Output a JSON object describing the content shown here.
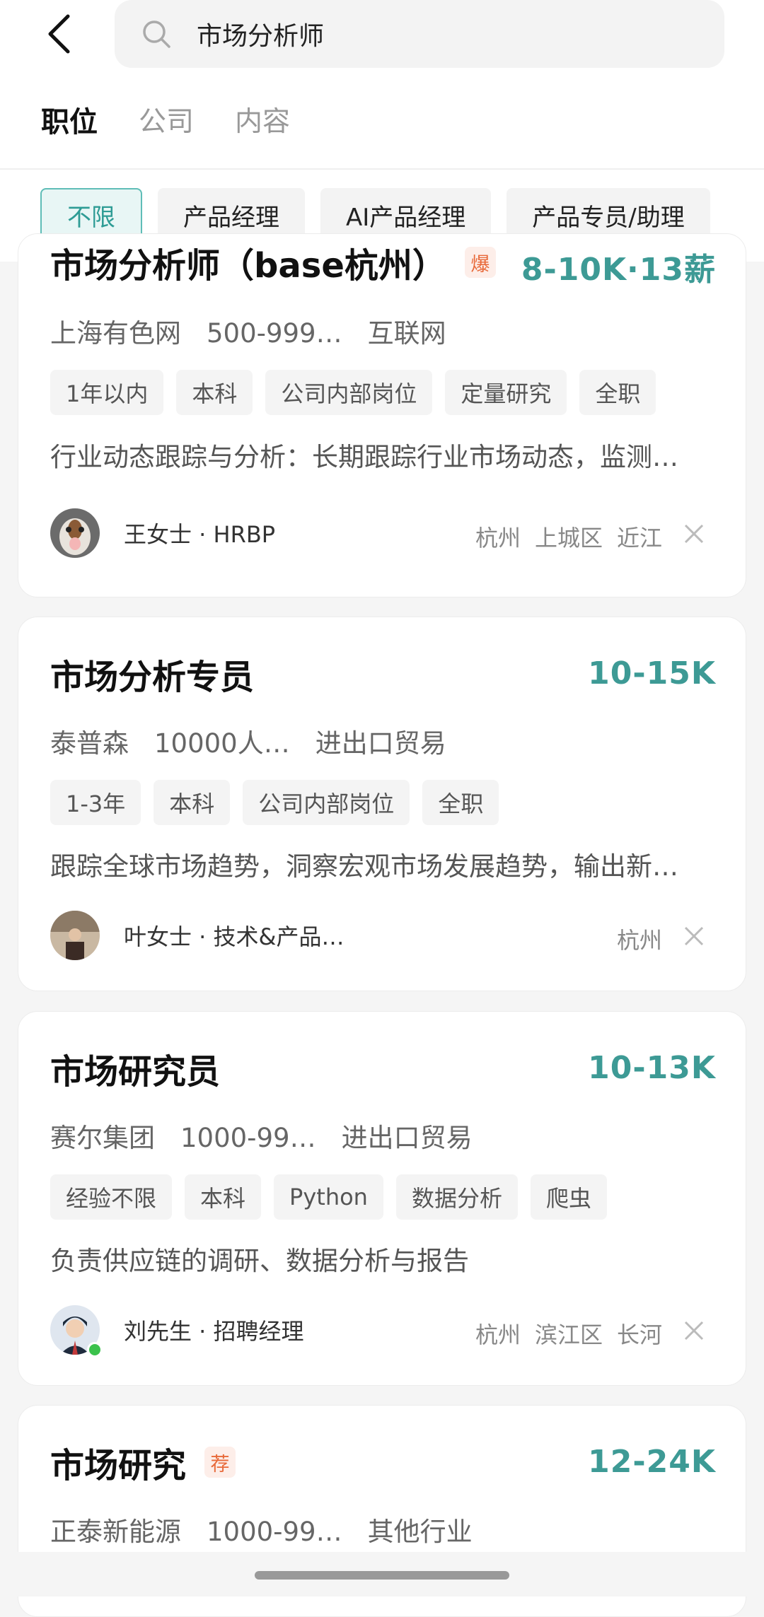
{
  "search": {
    "query": "市场分析师"
  },
  "tabs": [
    {
      "label": "职位",
      "active": true
    },
    {
      "label": "公司",
      "active": false
    },
    {
      "label": "内容",
      "active": false
    }
  ],
  "filters": [
    {
      "label": "不限",
      "active": true
    },
    {
      "label": "产品经理",
      "active": false
    },
    {
      "label": "AI产品经理",
      "active": false
    },
    {
      "label": "产品专员/助理",
      "active": false
    }
  ],
  "jobs": [
    {
      "title": "市场分析师（base杭州）",
      "badge": "爆",
      "salary": "8-10K·13薪",
      "company": "上海有色网",
      "size": "500-999…",
      "industry": "互联网",
      "tags": [
        "1年以内",
        "本科",
        "公司内部岗位",
        "定量研究",
        "全职"
      ],
      "desc": "行业动态跟踪与分析：长期跟踪行业市场动态，监测…",
      "recruiter": "王女士 · HRBP",
      "location": [
        "杭州",
        "上城区",
        "近江"
      ],
      "online": false
    },
    {
      "title": "市场分析专员",
      "badge": "",
      "salary": "10-15K",
      "company": "泰普森",
      "size": "10000人…",
      "industry": "进出口贸易",
      "tags": [
        "1-3年",
        "本科",
        "公司内部岗位",
        "全职"
      ],
      "desc": "跟踪全球市场趋势，洞察宏观市场发展趋势，输出新…",
      "recruiter": "叶女士 · 技术&产品…",
      "location": [
        "杭州"
      ],
      "online": false
    },
    {
      "title": "市场研究员",
      "badge": "",
      "salary": "10-13K",
      "company": "赛尔集团",
      "size": "1000-99…",
      "industry": "进出口贸易",
      "tags": [
        "经验不限",
        "本科",
        "Python",
        "数据分析",
        "爬虫"
      ],
      "desc": "负责供应链的调研、数据分析与报告",
      "recruiter": "刘先生 · 招聘经理",
      "location": [
        "杭州",
        "滨江区",
        "长河"
      ],
      "online": true
    },
    {
      "title": "市场研究",
      "badge": "荐",
      "salary": "12-24K",
      "company": "正泰新能源",
      "size": "1000-99…",
      "industry": "其他行业"
    }
  ],
  "colors": {
    "accent": "#3d9a95",
    "badge": "#e86a3a",
    "online": "#3bc24c"
  }
}
